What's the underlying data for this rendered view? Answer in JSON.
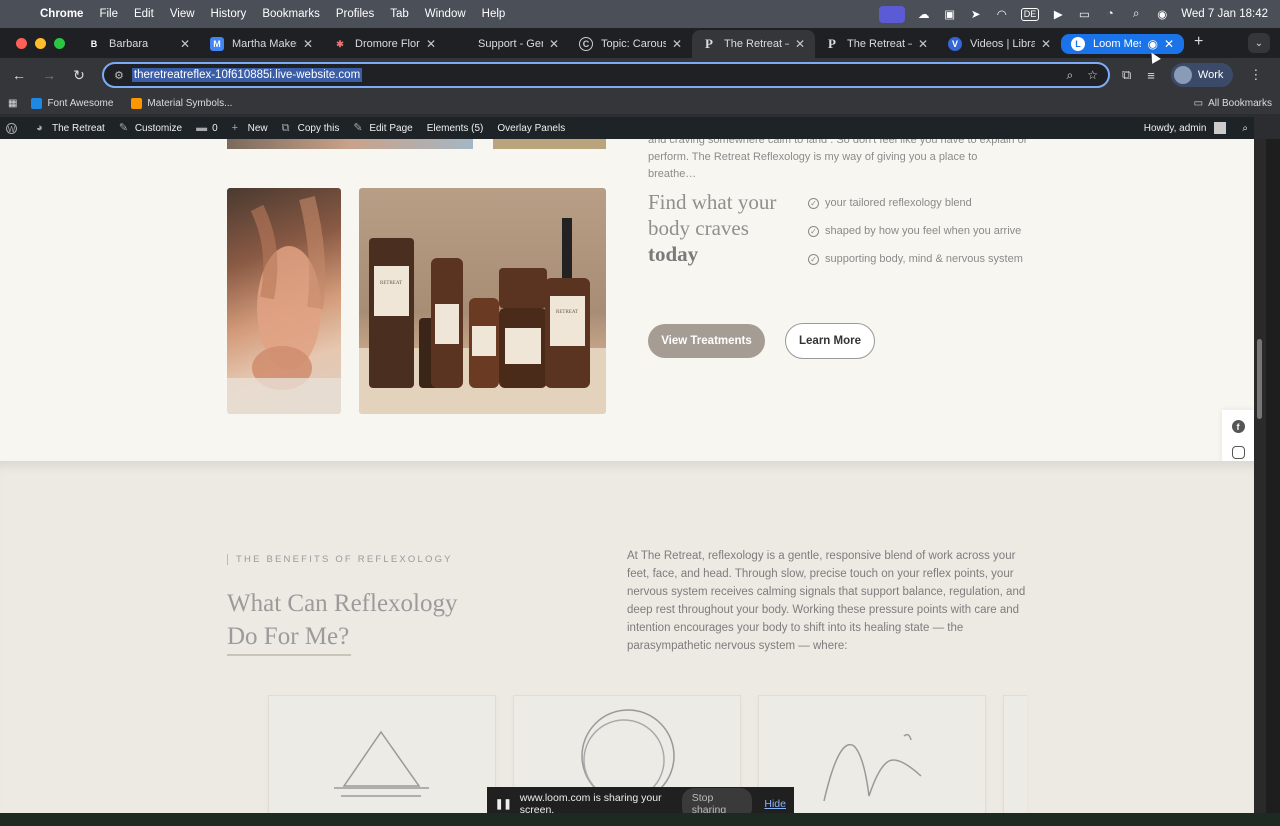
{
  "menubar": {
    "app": "Chrome",
    "items": [
      "File",
      "Edit",
      "View",
      "History",
      "Bookmarks",
      "Profiles",
      "Tab",
      "Window",
      "Help"
    ],
    "input_source": "DE",
    "datetime": "Wed 7 Jan  18:42"
  },
  "tabs": [
    {
      "title": "Barbara",
      "fav": "B",
      "color": "#1f2023"
    },
    {
      "title": "Martha Makes Yo",
      "fav": "M",
      "color": "#4285f4"
    },
    {
      "title": "Dromore Florist",
      "fav": "✱",
      "color": "#c2185b"
    },
    {
      "title": "Support - Gener",
      "fav": "S",
      "color": "#1f2023"
    },
    {
      "title": "Topic: Carousel",
      "fav": "C",
      "color": "#9e9e9e"
    },
    {
      "title": "The Retreat – RE",
      "fav": "R",
      "color": "#35363a"
    },
    {
      "title": "The Retreat – RE",
      "fav": "R",
      "color": "#1f2023"
    },
    {
      "title": "Videos | Library",
      "fav": "V",
      "color": "#3367d6"
    },
    {
      "title": "Loom Messe",
      "fav": "L",
      "color": "#1a73e8"
    }
  ],
  "toolbar": {
    "url": "theretreatreflex-10f610885i.live-website.com",
    "profile": "Work"
  },
  "bookmarks": {
    "items": [
      {
        "label": "Font Awesome",
        "color": "#1e88e5"
      },
      {
        "label": "Material Symbols...",
        "color": "#ff9800"
      }
    ],
    "all": "All Bookmarks"
  },
  "wpbar": {
    "site": "The Retreat",
    "customize": "Customize",
    "comments": "0",
    "new": "New",
    "copy": "Copy this",
    "edit": "Edit Page",
    "elements": "Elements (5)",
    "overlay": "Overlay Panels",
    "howdy": "Howdy, admin"
  },
  "page": {
    "intro_tail_line1": "and craving somewhere calm to land . So don't feel like you have to explain or",
    "intro_tail_line2": "perform. The Retreat Reflexology is my way of giving you a place to breathe…",
    "crave_heading_1": "Find what your",
    "crave_heading_2": "body craves",
    "crave_heading_bold": "today",
    "checklist": [
      "your tailored reflexology blend",
      "shaped by how you feel when you arrive",
      "supporting body, mind & nervous system"
    ],
    "btn_view": "View Treatments",
    "btn_learn": "Learn More",
    "product_label": "RETREAT",
    "benefits_eyebrow": "THE BENEFITS OF REFLEXOLOGY",
    "benefits_title_1": "What Can Reflexology",
    "benefits_title_2": "Do For Me?",
    "benefits_text": "At The Retreat, reflexology is a gentle, responsive blend of work across your feet, face, and head. Through slow, precise touch on your reflex points, your nervous system receives calming signals that support balance, regulation, and deep rest throughout your body. Working these pressure points with care and intention encourages your body to shift into its healing state — the parasympathetic nervous system — where:"
  },
  "social": [
    "facebook-icon",
    "instagram-icon",
    "linkedin-icon",
    "x-icon"
  ],
  "loom": {
    "message": "www.loom.com is sharing your screen.",
    "stop": "Stop sharing",
    "hide": "Hide"
  }
}
